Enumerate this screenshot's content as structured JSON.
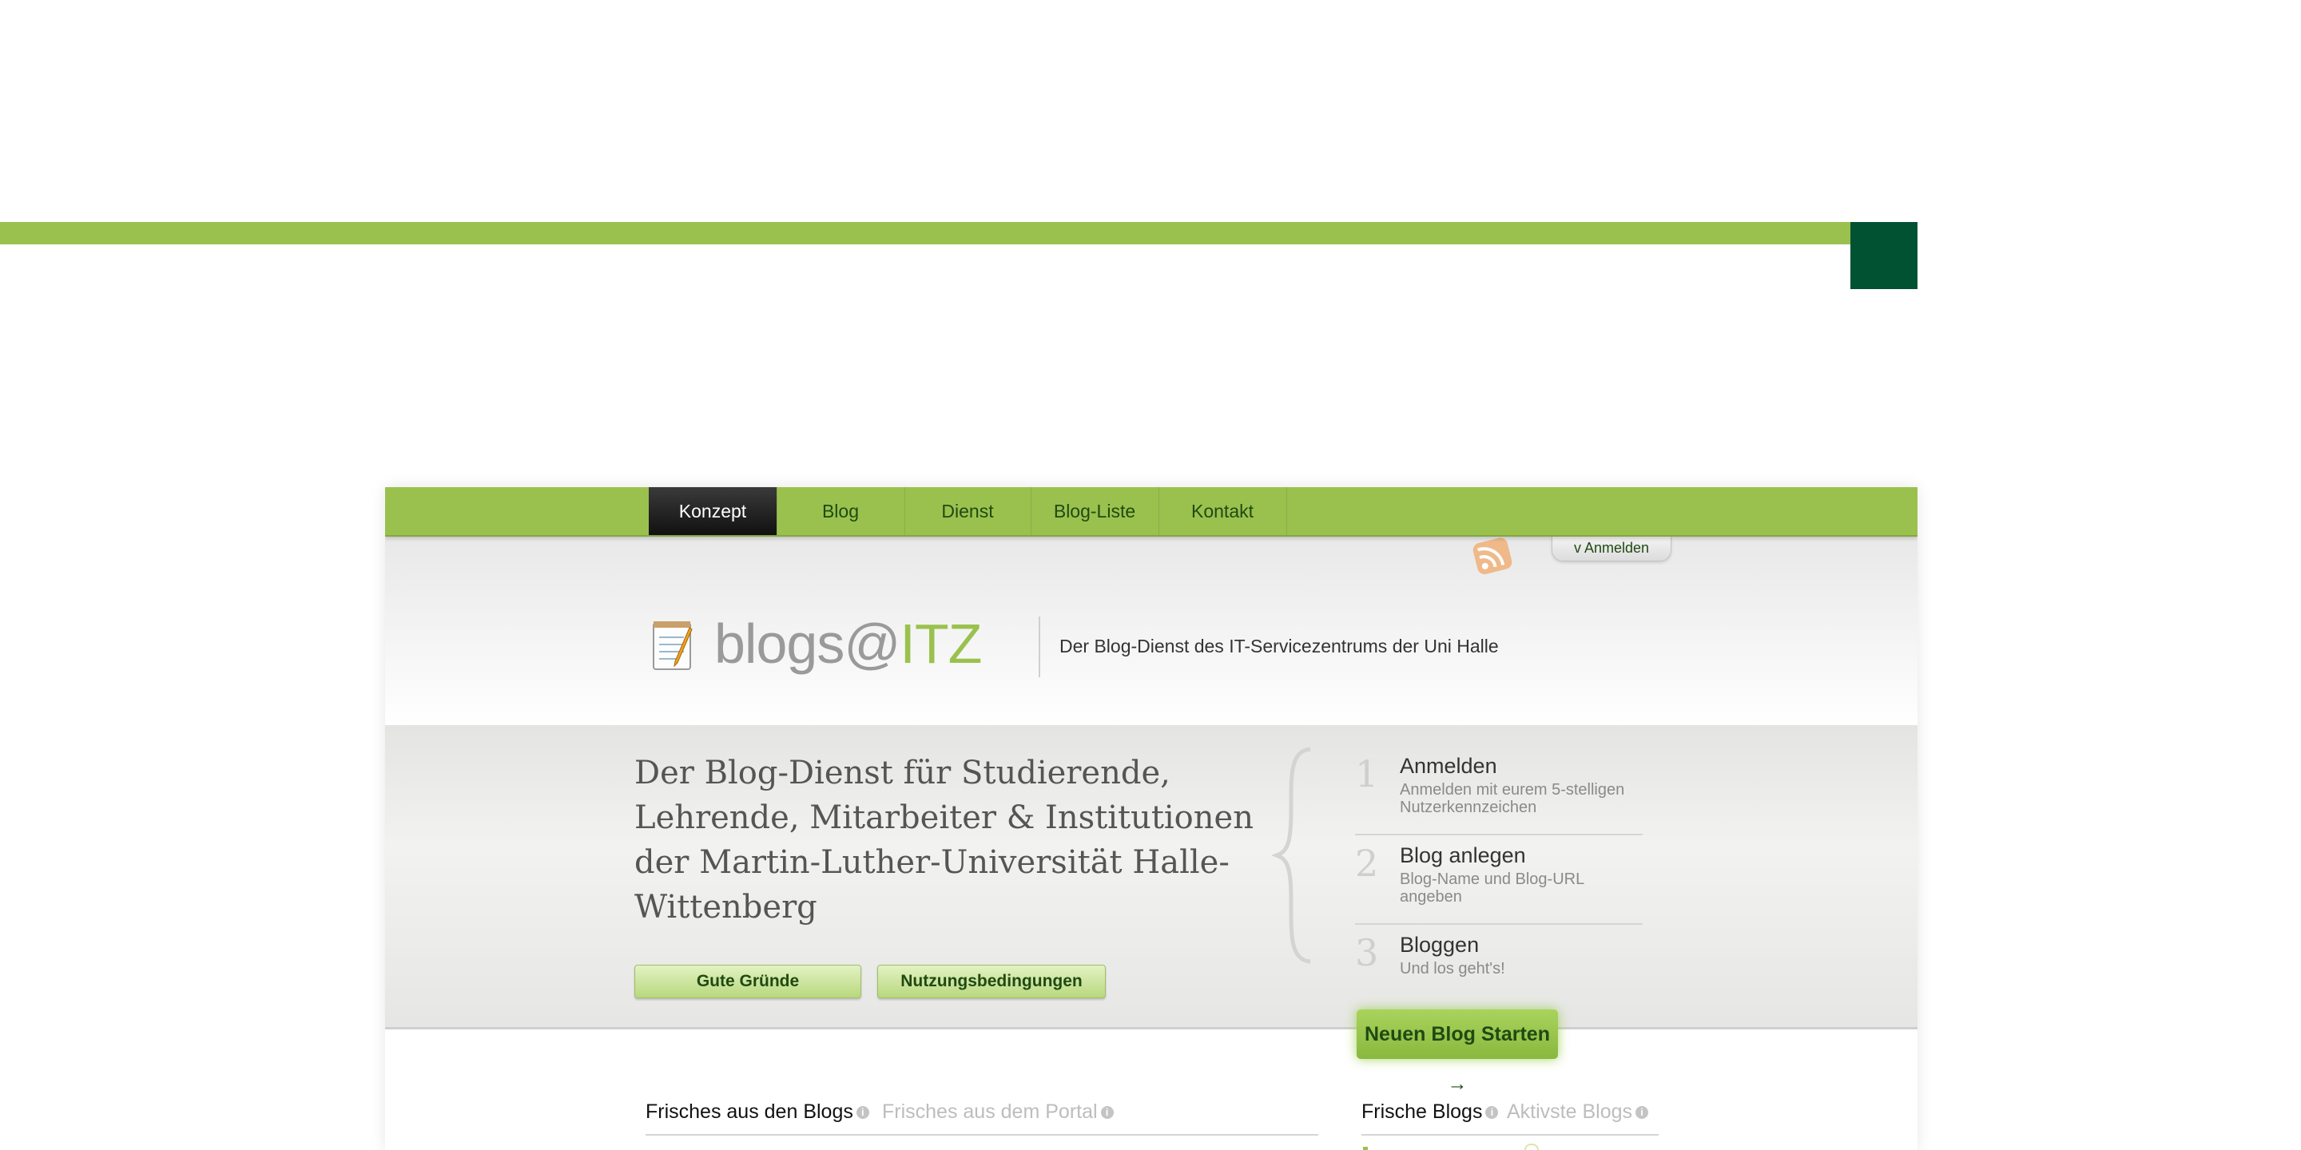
{
  "colors": {
    "brand_green": "#9ac14e",
    "dark_green": "#005232",
    "nav_active": "#1a1a1a"
  },
  "nav": {
    "items": [
      {
        "label": "Konzept",
        "active": true
      },
      {
        "label": "Blog"
      },
      {
        "label": "Dienst"
      },
      {
        "label": "Blog-Liste"
      },
      {
        "label": "Kontakt"
      }
    ]
  },
  "header": {
    "login_label": "v Anmelden",
    "rss_icon": "rss-icon",
    "logo_icon": "notepad-icon",
    "logo_text_main": "blogs@",
    "logo_text_accent": "ITZ",
    "tagline": "Der Blog-Dienst des IT-Servicezentrums der Uni Halle"
  },
  "hero": {
    "title": "Der Blog-Dienst für Studierende, Lehrende, Mitarbeiter & Institutionen der Martin-Luther-Universität Halle-Wittenberg",
    "buttons": [
      {
        "label": "Gute Gründe"
      },
      {
        "label": "Nutzungsbedingungen"
      }
    ],
    "steps": [
      {
        "num": "1",
        "title": "Anmelden",
        "desc": "Anmelden mit eurem 5-stelligen Nutzerkennzeichen"
      },
      {
        "num": "2",
        "title": "Blog anlegen",
        "desc": "Blog-Name und Blog-URL angeben"
      },
      {
        "num": "3",
        "title": "Bloggen",
        "desc": "Und los geht's!"
      }
    ],
    "start_button": "Neuen Blog Starten →"
  },
  "feeds": {
    "left_tabs": [
      {
        "label": "Frisches aus den Blogs",
        "active": true
      },
      {
        "label": "Frisches aus dem Portal",
        "active": false
      }
    ],
    "right_tabs": [
      {
        "label": "Frische Blogs",
        "active": true
      },
      {
        "label": "Aktivste Blogs",
        "active": false
      }
    ],
    "info_icon": "info-icon"
  }
}
